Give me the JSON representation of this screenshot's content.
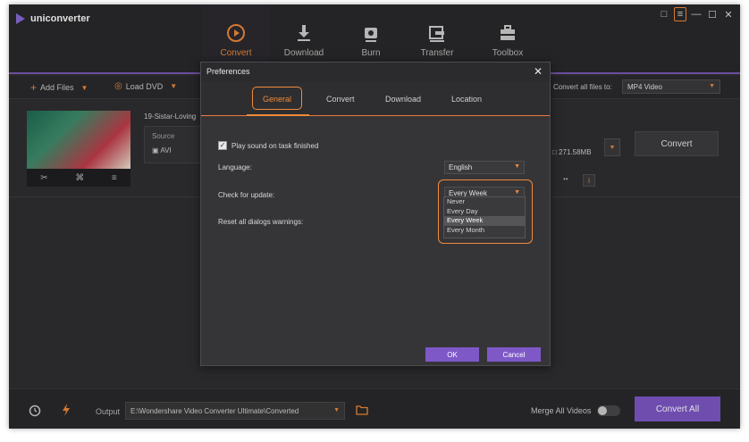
{
  "app": {
    "name": "uniconverter"
  },
  "nav": [
    {
      "label": "Convert",
      "icon": "convert-icon",
      "active": true
    },
    {
      "label": "Download",
      "icon": "download-icon",
      "active": false
    },
    {
      "label": "Burn",
      "icon": "burn-icon",
      "active": false
    },
    {
      "label": "Transfer",
      "icon": "transfer-icon",
      "active": false
    },
    {
      "label": "Toolbox",
      "icon": "toolbox-icon",
      "active": false
    }
  ],
  "toolbar": {
    "add_files": "Add Files",
    "load_dvd": "Load DVD",
    "convert_all_label": "Convert all files to:",
    "convert_all_value": "MP4 Video"
  },
  "file": {
    "name": "19-Sistar-Loving",
    "source_label": "Source",
    "source_format": "AVI",
    "size": "271.58MB",
    "convert_label": "Convert"
  },
  "bottom": {
    "output_label": "Output",
    "output_path": "E:\\Wondershare Video Converter Ultimate\\Converted",
    "merge_label": "Merge All Videos",
    "merge_on": false,
    "convert_all_btn": "Convert All"
  },
  "dialog": {
    "title": "Preferences",
    "tabs": [
      {
        "label": "General",
        "active": true
      },
      {
        "label": "Convert",
        "active": false
      },
      {
        "label": "Download",
        "active": false
      },
      {
        "label": "Location",
        "active": false
      }
    ],
    "play_sound_label": "Play sound on task finished",
    "play_sound_checked": true,
    "language_label": "Language:",
    "language_value": "English",
    "check_update_label": "Check for update:",
    "check_update_value": "Every Week",
    "check_update_options": [
      "Never",
      "Every Day",
      "Every Week",
      "Every Month"
    ],
    "check_update_selected_index": 2,
    "reset_label": "Reset all dialogs warnings:",
    "ok_label": "OK",
    "cancel_label": "Cancel"
  },
  "colors": {
    "accent": "#f28a3a",
    "brand": "#7f58c8"
  }
}
